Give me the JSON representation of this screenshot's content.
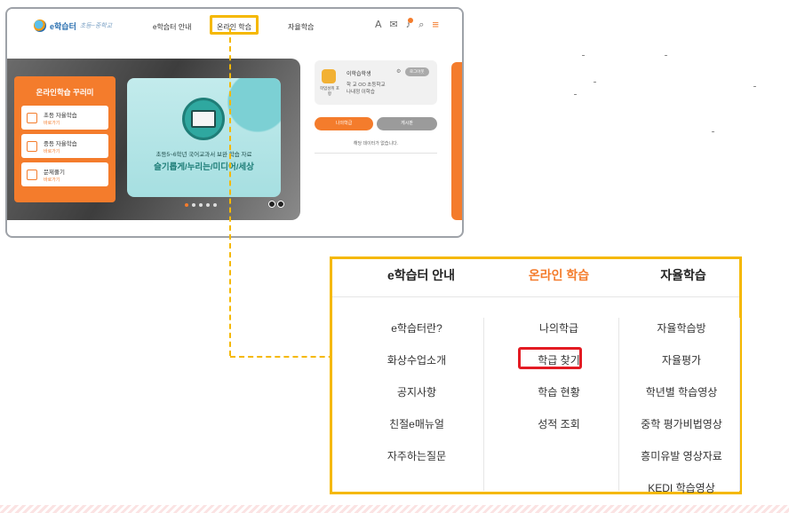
{
  "site": {
    "logo_text": "e학습터",
    "logo_sub": "초등~중학교"
  },
  "topnav": {
    "items": [
      "e학습터 안내",
      "온라인 학습",
      "자율학습"
    ],
    "highlighted": "온라인 학습",
    "icons": [
      "user-icon",
      "message-icon",
      "bell-icon",
      "search-icon",
      "menu-icon"
    ]
  },
  "hero": {
    "menu_card": {
      "title": "온라인학습 꾸러미",
      "rows": [
        {
          "title": "초등 자율학습",
          "sub": "바로가기"
        },
        {
          "title": "중등 자율학습",
          "sub": "바로가기"
        },
        {
          "title": "문제풀기",
          "sub": "바로가기"
        }
      ]
    },
    "banner": {
      "subtitle": "초등5~6학년 국어교과서 보완 학습 자료",
      "title": "슬기롭게/누리는/미디어/세상"
    }
  },
  "profile": {
    "avatar_caption": "학업성취 포항",
    "name": "이학습학생",
    "badge": "로그아웃",
    "school_label": "학 교",
    "school_value": "OO 초등학교",
    "class_label": "나내정",
    "class_value": "이학습",
    "btn_mine": "나의학급",
    "btn_board": "게시판",
    "no_data": "해당 데이터가 없습니다."
  },
  "menu_panel": {
    "columns": [
      {
        "header": "e학습터 안내",
        "items": [
          "e학습터란?",
          "화상수업소개",
          "공지사항",
          "친절e매뉴얼",
          "자주하는질문"
        ]
      },
      {
        "header": "온라인 학습",
        "items": [
          "나의학급",
          "학급 찾기",
          "학습 현황",
          "성적 조회"
        ]
      },
      {
        "header": "자율학습",
        "items": [
          "자율학습방",
          "자율평가",
          "학년별 학습영상",
          "중학 평가비법영상",
          "흥미유발 영상자료",
          "KEDI 학습영상"
        ]
      }
    ],
    "highlighted_item": "학급 찾기"
  },
  "colors": {
    "accent_orange": "#f47c2c",
    "highlight_yellow": "#f5b800",
    "highlight_red": "#e31b23"
  }
}
